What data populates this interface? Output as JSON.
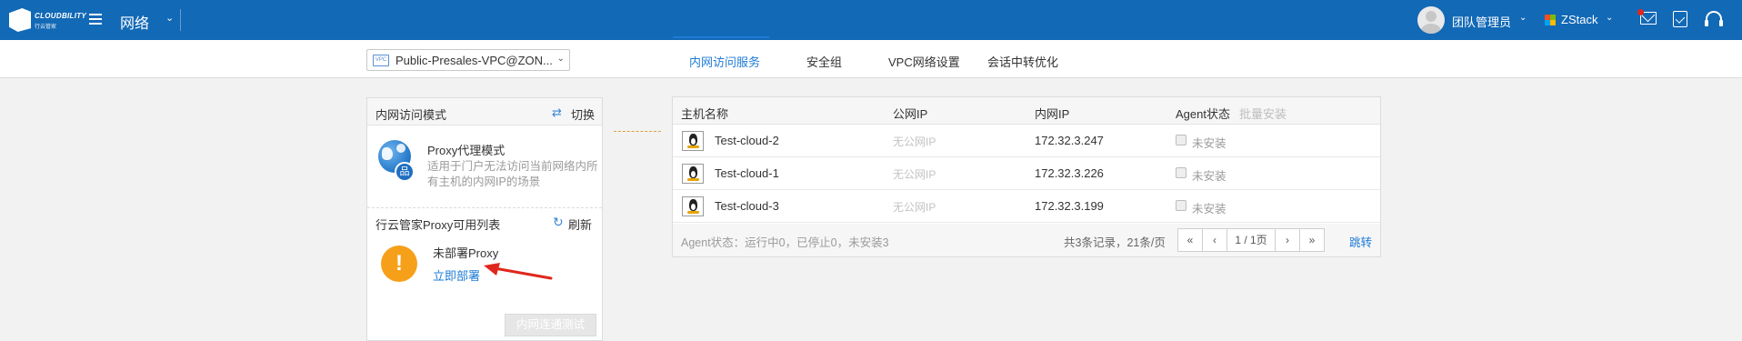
{
  "topbar": {
    "brand": "CLOUDBILITY",
    "brand_sub": "行云管家",
    "module_title": "网络",
    "user_name": "团队管理员",
    "tenant_name": "ZStack"
  },
  "subnav": {
    "vpc_badge": "VPC",
    "vpc_selected": "Public-Presales-VPC@ZON...",
    "tabs": [
      "内网访问服务",
      "安全组",
      "VPC网络设置",
      "会话中转优化"
    ],
    "active_tab": "内网访问服务"
  },
  "left_panel": {
    "title": "内网访问模式",
    "switch_label": "切换",
    "mode_title": "Proxy代理模式",
    "mode_desc": "适用于门户无法访问当前网络内所有主机的内网IP的场景",
    "proxy_list_title": "行云管家Proxy可用列表",
    "refresh_label": "刷新",
    "no_proxy_text": "未部署Proxy",
    "deploy_link": "立即部署",
    "test_button": "内网连通测试"
  },
  "table": {
    "columns": [
      "主机名称",
      "公网IP",
      "内网IP",
      "Agent状态"
    ],
    "bulk_install": "批量安装",
    "rows": [
      {
        "name": "Test-cloud-2",
        "public_ip": "无公网IP",
        "private_ip": "172.32.3.247",
        "agent_status": "未安装"
      },
      {
        "name": "Test-cloud-1",
        "public_ip": "无公网IP",
        "private_ip": "172.32.3.226",
        "agent_status": "未安装"
      },
      {
        "name": "Test-cloud-3",
        "public_ip": "无公网IP",
        "private_ip": "172.32.3.199",
        "agent_status": "未安装"
      }
    ],
    "footer": {
      "agent_summary": "Agent状态：运行中0，已停止0，未安装3",
      "page_info": "共3条记录，21条/页",
      "first": "«",
      "prev": "‹",
      "page": "1 / 1页",
      "next": "›",
      "last": "»",
      "jump": "跳转"
    }
  },
  "colors": {
    "topbar": "#1269b6",
    "accent": "#1e7bd6",
    "warning": "#f6a01a",
    "annotation_arrow": "#e0261c"
  }
}
